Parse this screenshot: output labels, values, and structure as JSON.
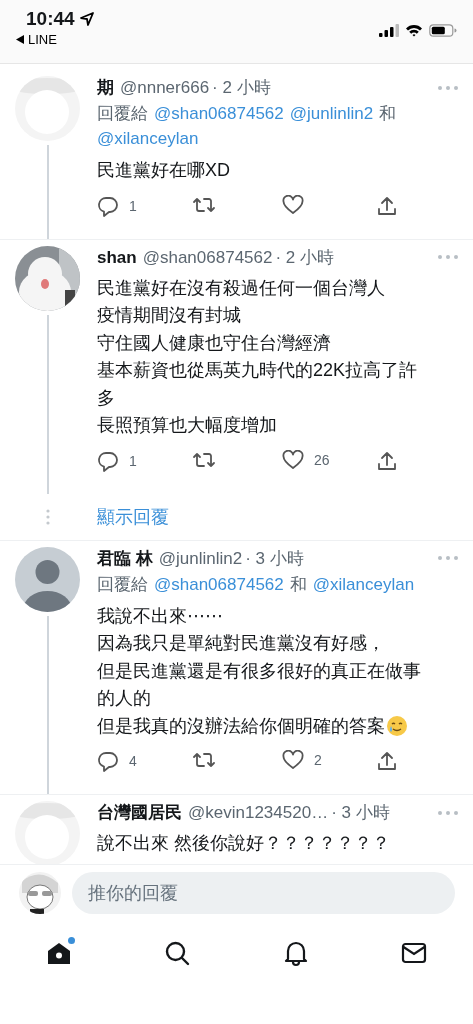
{
  "status_bar": {
    "time": "10:44",
    "back_label": "LINE"
  },
  "tweets": [
    {
      "name": "期",
      "handle": "@nnner666",
      "time": "· 2 小時",
      "avatar": {
        "kind": "picture"
      },
      "thread_line": true,
      "reply_to": [
        {
          "kind": "plain",
          "text": "回覆給"
        },
        {
          "kind": "mention",
          "text": "@shan06874562"
        },
        {
          "kind": "mention",
          "text": "@junlinlin2"
        },
        {
          "kind": "plain",
          "text": "和"
        },
        {
          "kind": "mention",
          "text": "@xilanceylan"
        }
      ],
      "lines": [
        "民進黨好在哪XD"
      ],
      "ends_with_emoji": false,
      "actions": {
        "replies": "1"
      }
    },
    {
      "name": "shan",
      "handle": "@shan06874562",
      "time": "· 2 小時",
      "avatar": {
        "kind": "picture"
      },
      "thread_line": true,
      "lines": [
        "民進黨好在沒有殺過任何一個台灣人",
        "疫情期間沒有封城",
        "守住國人健康也守住台灣經濟",
        "基本薪資也從馬英九時代的22K拉高了許",
        "多",
        "長照預算也大幅度增加"
      ],
      "ends_with_emoji": false,
      "actions": {
        "replies": "1",
        "likes": "26"
      },
      "show_replies": "顯示回覆"
    },
    {
      "name": "君臨 林",
      "handle": "@junlinlin2",
      "time": "· 3 小時",
      "avatar": {
        "kind": "default"
      },
      "thread_line": true,
      "reply_to": [
        {
          "kind": "plain",
          "text": "回覆給"
        },
        {
          "kind": "mention",
          "text": "@shan06874562"
        },
        {
          "kind": "plain",
          "text": "和"
        },
        {
          "kind": "mention",
          "text": "@xilanceylan"
        }
      ],
      "lines": [
        "我說不出來⋯⋯",
        "因為我只是單純對民進黨沒有好感，",
        "但是民進黨還是有很多很好的真正在做事",
        "的人的",
        "但是我真的沒辦法給你個明確的答案"
      ],
      "ends_with_emoji": true,
      "actions": {
        "replies": "4",
        "likes": "2"
      }
    },
    {
      "name": "台灣國居民",
      "handle": "@kevin1234520…",
      "time": "· 3 小時",
      "avatar": {
        "kind": "picture"
      },
      "thread_line": false,
      "lines": [
        "說不出來 然後你說好？？？？？？？"
      ],
      "ends_with_emoji": false
    }
  ],
  "reply_bar": {
    "placeholder": "推你的回覆"
  },
  "tab_bar": [
    {
      "kind": "home",
      "selected": true,
      "badge": true
    },
    {
      "kind": "search",
      "selected": false,
      "badge": false
    },
    {
      "kind": "notifications",
      "selected": false,
      "badge": false
    },
    {
      "kind": "messages",
      "selected": false,
      "badge": false
    }
  ]
}
